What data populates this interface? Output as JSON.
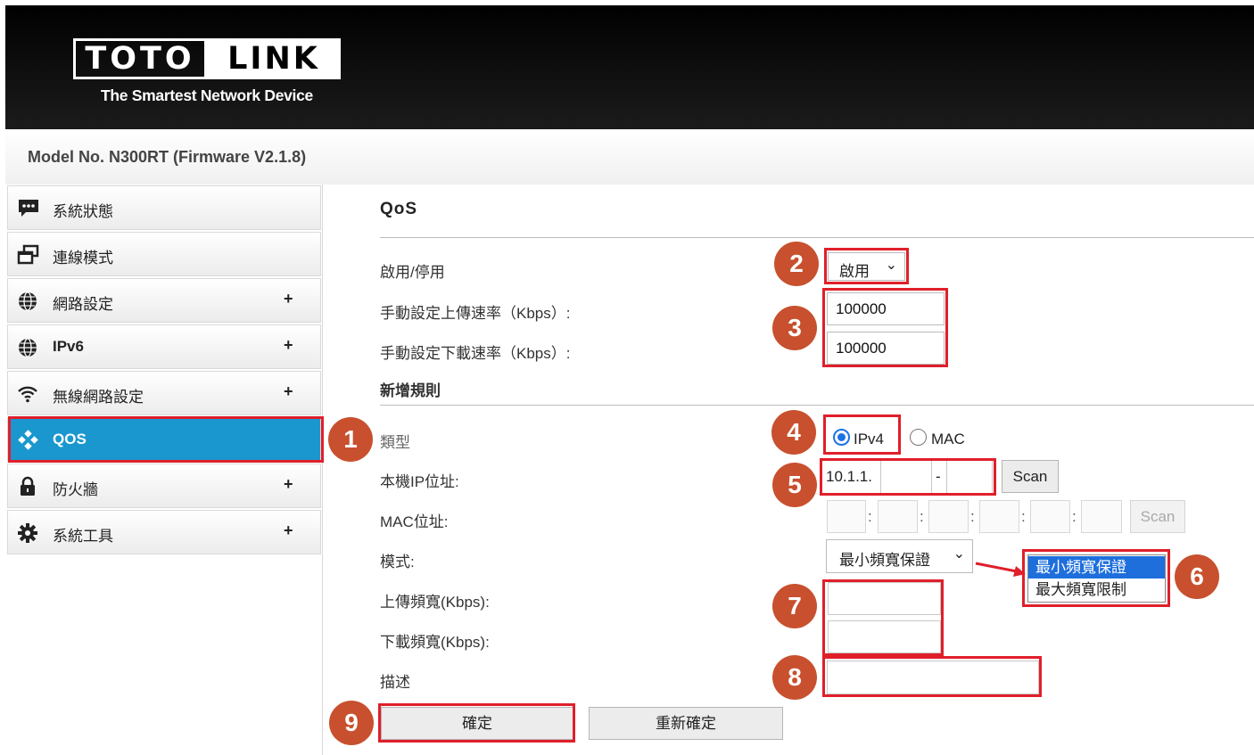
{
  "brand": {
    "logo_left": "TOTO",
    "logo_right": "LINK",
    "tagline": "The Smartest Network Device"
  },
  "model": "Model No. N300RT (Firmware V2.1.8)",
  "sidebar": {
    "items": [
      {
        "label": "系統狀態",
        "icon": "chat-bubble-icon",
        "expandable": false
      },
      {
        "label": "連線模式",
        "icon": "windows-icon",
        "expandable": false
      },
      {
        "label": "網路設定",
        "icon": "globe-icon",
        "expandable": true,
        "plus": "+"
      },
      {
        "label": "IPv6",
        "icon": "globe-icon",
        "expandable": true,
        "plus": "+"
      },
      {
        "label": "無線網路設定",
        "icon": "wifi-icon",
        "expandable": true,
        "plus": "+"
      },
      {
        "label": "QOS",
        "icon": "qos-diamond-icon",
        "expandable": false,
        "active": true
      },
      {
        "label": "防火牆",
        "icon": "lock-icon",
        "expandable": true,
        "plus": "+"
      },
      {
        "label": "系統工具",
        "icon": "gear-icon",
        "expandable": true,
        "plus": "+"
      }
    ]
  },
  "main": {
    "title": "QoS",
    "enable_label": "啟用/停用",
    "enable_value": "啟用",
    "upload_rate_label": "手動設定上傳速率（Kbps）:",
    "upload_rate_value": "100000",
    "download_rate_label": "手動設定下載速率（Kbps）:",
    "download_rate_value": "100000",
    "new_rule_heading": "新增規則",
    "type_label": "類型",
    "type_ipv4": "IPv4",
    "type_mac": "MAC",
    "local_ip_label": "本機IP位址:",
    "ip_prefix": "10.1.1.",
    "ip_dash": "-",
    "scan_label": "Scan",
    "mac_label": "MAC位址:",
    "mac_sep": ":",
    "mode_label": "模式:",
    "mode_value": "最小頻寬保證",
    "mode_options": [
      "最小頻寬保證",
      "最大頻寬限制"
    ],
    "upload_bw_label": "上傳頻寬(Kbps):",
    "download_bw_label": "下載頻寬(Kbps):",
    "desc_label": "描述",
    "confirm_label": "確定",
    "reset_label": "重新確定"
  },
  "annotations": {
    "badges": [
      "1",
      "2",
      "3",
      "4",
      "5",
      "6",
      "7",
      "8",
      "9"
    ],
    "color": "#e01f2a",
    "badge_color": "#c8502e"
  },
  "colors": {
    "accent": "#1a97cf",
    "header": "#000000"
  }
}
